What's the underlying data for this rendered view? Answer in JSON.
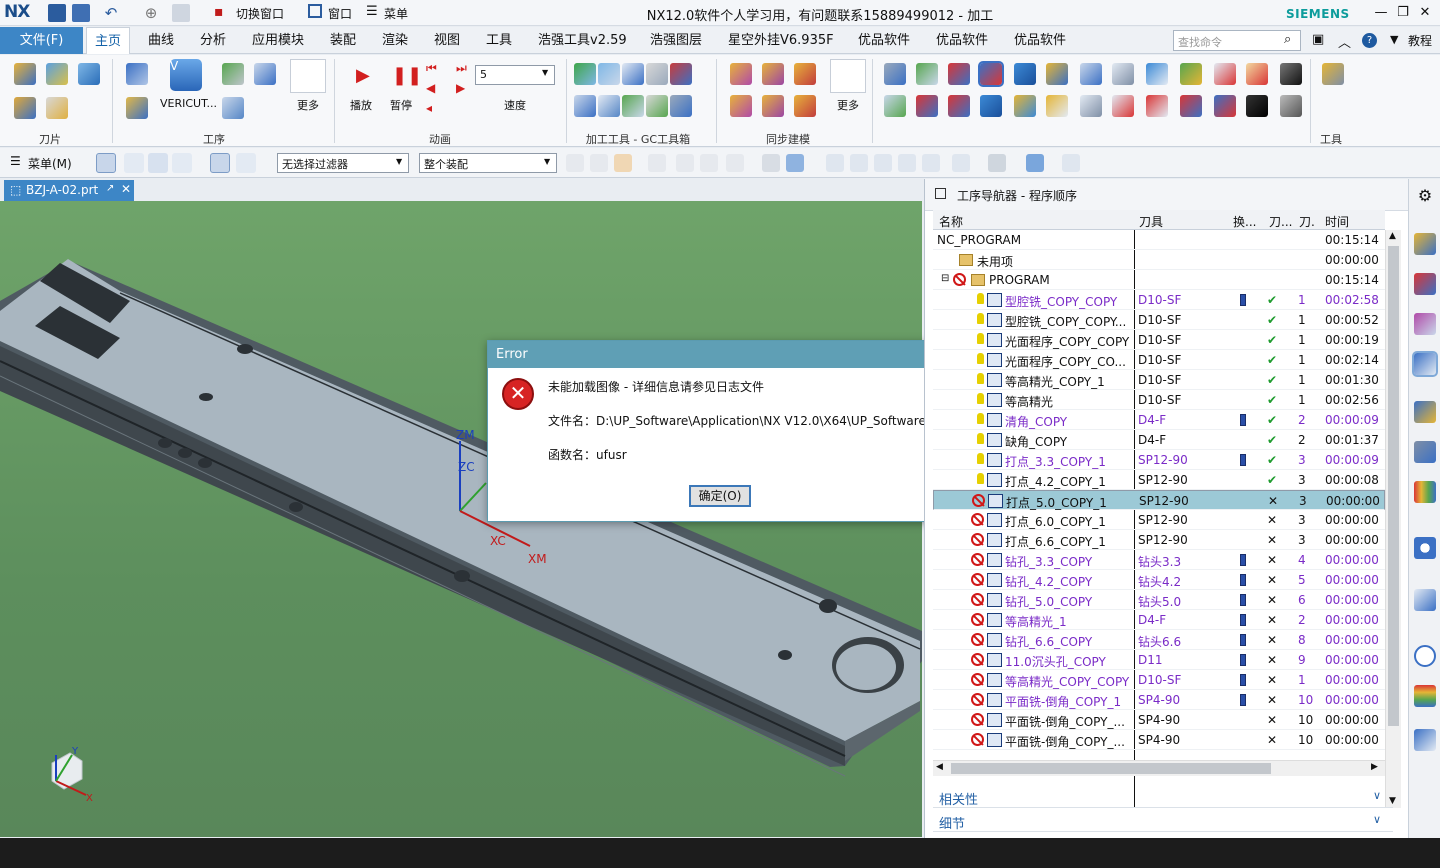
{
  "window": {
    "app_logo": "NX",
    "title": "NX12.0软件个人学习用，有问题联系15889499012 - 加工",
    "brand": "SIEMENS",
    "quick_access": {
      "switch_window": "切换窗口",
      "window": "窗口",
      "menu": "菜单"
    }
  },
  "menubar": {
    "file": "文件(F)",
    "tabs": [
      "主页",
      "曲线",
      "分析",
      "应用模块",
      "装配",
      "渲染",
      "视图",
      "工具",
      "浩强工具v2.59",
      "浩强图层",
      "星空外挂V6.935F",
      "优品软件",
      "优品软件",
      "优品软件"
    ],
    "active_tab": "主页",
    "search_placeholder": "查找命令",
    "tutorial": "教程"
  },
  "ribbon": {
    "groups": {
      "tool": "刀片",
      "process": "工序",
      "animation": "动画",
      "machining_tools": "加工工具 - GC工具箱",
      "sync_modeling": "同步建模",
      "tools": "工具"
    },
    "labels": {
      "vericut": "VERICUT...",
      "more1": "更多",
      "play": "播放",
      "pause": "暂停",
      "speed_value": "5",
      "speed": "速度",
      "more2": "更多"
    }
  },
  "toolbar2": {
    "menu": "菜单(M)",
    "filter": "无选择过滤器",
    "assembly": "整个装配"
  },
  "document": {
    "tab": "BZJ-A-02.prt"
  },
  "viewport": {
    "axis_labels": {
      "zm": "ZM",
      "zc": "ZC",
      "xc": "XC",
      "xm": "XM",
      "triad_y": "Y",
      "triad_x": "X"
    }
  },
  "navigator": {
    "title": "工序导航器 - 程序顺序",
    "columns": [
      "名称",
      "刀具",
      "换...",
      "刀...",
      "刀.",
      "时间"
    ],
    "root": {
      "name": "NC_PROGRAM",
      "time": "00:15:14"
    },
    "unused": {
      "name": "未用项",
      "time": "00:00:00"
    },
    "program": {
      "name": "PROGRAM",
      "time": "00:15:14"
    },
    "rows": [
      {
        "name": "型腔铣_COPY_COPY",
        "tool": "D10-SF",
        "change": true,
        "status": "ok",
        "count": "1",
        "time": "00:02:58",
        "purple": true,
        "icon": "bulb"
      },
      {
        "name": "型腔铣_COPY_COPY...",
        "tool": "D10-SF",
        "change": false,
        "status": "ok",
        "count": "1",
        "time": "00:00:52",
        "purple": false,
        "icon": "bulb"
      },
      {
        "name": "光面程序_COPY_COPY",
        "tool": "D10-SF",
        "change": false,
        "status": "ok",
        "count": "1",
        "time": "00:00:19",
        "purple": false,
        "icon": "bulb"
      },
      {
        "name": "光面程序_COPY_CO...",
        "tool": "D10-SF",
        "change": false,
        "status": "ok",
        "count": "1",
        "time": "00:02:14",
        "purple": false,
        "icon": "bulb"
      },
      {
        "name": "等高精光_COPY_1",
        "tool": "D10-SF",
        "change": false,
        "status": "ok",
        "count": "1",
        "time": "00:01:30",
        "purple": false,
        "icon": "bulb"
      },
      {
        "name": "等高精光",
        "tool": "D10-SF",
        "change": false,
        "status": "ok",
        "count": "1",
        "time": "00:02:56",
        "purple": false,
        "icon": "bulb"
      },
      {
        "name": "清角_COPY",
        "tool": "D4-F",
        "change": true,
        "status": "ok",
        "count": "2",
        "time": "00:00:09",
        "purple": true,
        "icon": "bulb"
      },
      {
        "name": "缺角_COPY",
        "tool": "D4-F",
        "change": false,
        "status": "ok",
        "count": "2",
        "time": "00:01:37",
        "purple": false,
        "icon": "bulb"
      },
      {
        "name": "打点_3.3_COPY_1",
        "tool": "SP12-90",
        "change": true,
        "status": "ok",
        "count": "3",
        "time": "00:00:09",
        "purple": true,
        "icon": "bulb"
      },
      {
        "name": "打点_4.2_COPY_1",
        "tool": "SP12-90",
        "change": false,
        "status": "ok",
        "count": "3",
        "time": "00:00:08",
        "purple": false,
        "icon": "bulb"
      },
      {
        "name": "打点_5.0_COPY_1",
        "tool": "SP12-90",
        "change": false,
        "status": "no",
        "count": "3",
        "time": "00:00:00",
        "purple": false,
        "icon": "stop",
        "selected": true
      },
      {
        "name": "打点_6.0_COPY_1",
        "tool": "SP12-90",
        "change": false,
        "status": "no",
        "count": "3",
        "time": "00:00:00",
        "purple": false,
        "icon": "stop"
      },
      {
        "name": "打点_6.6_COPY_1",
        "tool": "SP12-90",
        "change": false,
        "status": "no",
        "count": "3",
        "time": "00:00:00",
        "purple": false,
        "icon": "stop"
      },
      {
        "name": "钻孔_3.3_COPY",
        "tool": "钻头3.3",
        "change": true,
        "status": "no",
        "count": "4",
        "time": "00:00:00",
        "purple": true,
        "icon": "stop"
      },
      {
        "name": "钻孔_4.2_COPY",
        "tool": "钻头4.2",
        "change": true,
        "status": "no",
        "count": "5",
        "time": "00:00:00",
        "purple": true,
        "icon": "stop"
      },
      {
        "name": "钻孔_5.0_COPY",
        "tool": "钻头5.0",
        "change": true,
        "status": "no",
        "count": "6",
        "time": "00:00:00",
        "purple": true,
        "icon": "stop"
      },
      {
        "name": "等高精光_1",
        "tool": "D4-F",
        "change": true,
        "status": "no",
        "count": "2",
        "time": "00:00:00",
        "purple": true,
        "icon": "stop"
      },
      {
        "name": "钻孔_6.6_COPY",
        "tool": "钻头6.6",
        "change": true,
        "status": "no",
        "count": "8",
        "time": "00:00:00",
        "purple": true,
        "icon": "stop"
      },
      {
        "name": "11.0沉头孔_COPY",
        "tool": "D11",
        "change": true,
        "status": "no",
        "count": "9",
        "time": "00:00:00",
        "purple": true,
        "icon": "stop"
      },
      {
        "name": "等高精光_COPY_COPY",
        "tool": "D10-SF",
        "change": true,
        "status": "no",
        "count": "1",
        "time": "00:00:00",
        "purple": true,
        "icon": "stop"
      },
      {
        "name": "平面铣-倒角_COPY_1",
        "tool": "SP4-90",
        "change": true,
        "status": "no",
        "count": "10",
        "time": "00:00:00",
        "purple": true,
        "icon": "stop"
      },
      {
        "name": "平面铣-倒角_COPY_...",
        "tool": "SP4-90",
        "change": false,
        "status": "no",
        "count": "10",
        "time": "00:00:00",
        "purple": false,
        "icon": "stop"
      },
      {
        "name": "平面铣-倒角_COPY_...",
        "tool": "SP4-90",
        "change": false,
        "status": "no",
        "count": "10",
        "time": "00:00:00",
        "purple": false,
        "icon": "stop"
      }
    ],
    "panels": {
      "dependencies": "相关性",
      "details": "细节"
    }
  },
  "dialog": {
    "title": "Error",
    "message": "未能加载图像 - 详细信息请参见日志文件",
    "file_label": "文件名：",
    "file_value": "D:\\UP_Software\\Application\\NX V12.0\\X64\\UP_Software.dll",
    "func_label": "函数名：",
    "func_value": "ufusr",
    "ok": "确定(O)"
  }
}
